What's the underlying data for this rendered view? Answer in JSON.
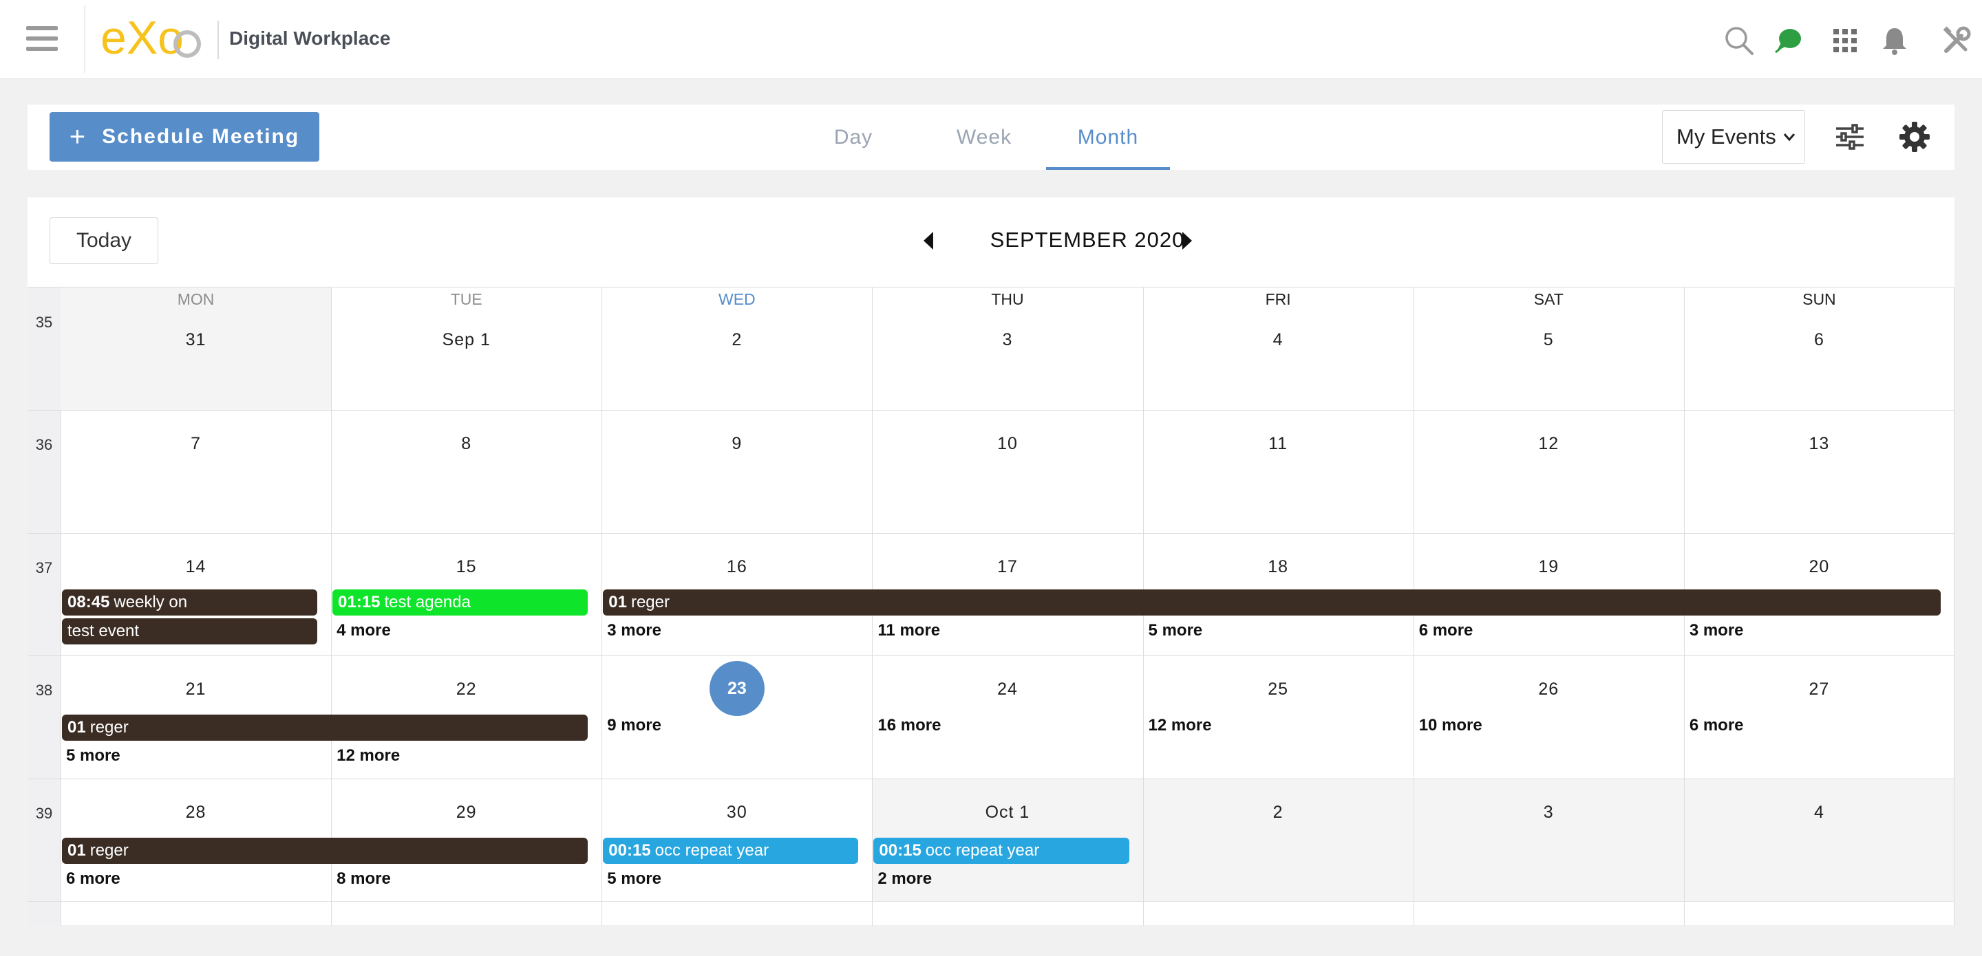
{
  "header": {
    "brand_title": "Digital Workplace",
    "logo_text": "eXo",
    "icons": [
      "menu-icon",
      "search-icon",
      "chat-icon",
      "apps-icon",
      "bell-icon",
      "tools-icon"
    ]
  },
  "toolbar": {
    "schedule_label": "Schedule Meeting",
    "tabs": [
      {
        "label": "Day",
        "active": false
      },
      {
        "label": "Week",
        "active": false
      },
      {
        "label": "Month",
        "active": true
      }
    ],
    "filter_value": "My Events"
  },
  "calendar": {
    "today_label": "Today",
    "month_title": "SEPTEMBER 2020",
    "day_headers": [
      "MON",
      "TUE",
      "WED",
      "THU",
      "FRI",
      "SAT",
      "SUN"
    ],
    "weeks": [
      {
        "num": "35",
        "days": [
          "31",
          "Sep 1",
          "2",
          "3",
          "4",
          "5",
          "6"
        ]
      },
      {
        "num": "36",
        "days": [
          "7",
          "8",
          "9",
          "10",
          "11",
          "12",
          "13"
        ]
      },
      {
        "num": "37",
        "days": [
          "14",
          "15",
          "16",
          "17",
          "18",
          "19",
          "20"
        ]
      },
      {
        "num": "38",
        "days": [
          "21",
          "22",
          "23",
          "24",
          "25",
          "26",
          "27"
        ]
      },
      {
        "num": "39",
        "days": [
          "28",
          "29",
          "30",
          "Oct 1",
          "2",
          "3",
          "4"
        ]
      }
    ],
    "today_date": "23",
    "events": [
      {
        "week": 2,
        "start": 0,
        "span": 1,
        "slot": 0,
        "time": "08:45",
        "title": "weekly on",
        "color": "#3b2d24"
      },
      {
        "week": 2,
        "start": 0,
        "span": 1,
        "slot": 1,
        "time": "",
        "title": "test event",
        "color": "#3b2d24"
      },
      {
        "week": 2,
        "start": 1,
        "span": 1,
        "slot": 0,
        "time": "01:15",
        "title": "test agenda",
        "color": "#0ee52a"
      },
      {
        "week": 2,
        "start": 2,
        "span": 5,
        "slot": 0,
        "time": "01",
        "title": "reger",
        "color": "#3b2d24"
      },
      {
        "week": 3,
        "start": 0,
        "span": 2,
        "slot": 0,
        "time": "01",
        "title": "reger",
        "color": "#3b2d24"
      },
      {
        "week": 4,
        "start": 0,
        "span": 2,
        "slot": 0,
        "time": "01",
        "title": "reger",
        "color": "#3b2d24"
      },
      {
        "week": 4,
        "start": 2,
        "span": 1,
        "slot": 0,
        "time": "00:15",
        "title": "occ repeat year",
        "color": "#27a6e0"
      },
      {
        "week": 4,
        "start": 3,
        "span": 1,
        "slot": 0,
        "time": "00:15",
        "title": "occ repeat year",
        "color": "#27a6e0"
      }
    ],
    "more_links": [
      {
        "week": 2,
        "day": 1,
        "slot": 1,
        "label": "4 more"
      },
      {
        "week": 2,
        "day": 2,
        "slot": 1,
        "label": "3 more"
      },
      {
        "week": 2,
        "day": 3,
        "slot": 1,
        "label": "11 more"
      },
      {
        "week": 2,
        "day": 4,
        "slot": 1,
        "label": "5 more"
      },
      {
        "week": 2,
        "day": 5,
        "slot": 1,
        "label": "6 more"
      },
      {
        "week": 2,
        "day": 6,
        "slot": 1,
        "label": "3 more"
      },
      {
        "week": 3,
        "day": 0,
        "slot": 1,
        "label": "5 more"
      },
      {
        "week": 3,
        "day": 1,
        "slot": 1,
        "label": "12 more"
      },
      {
        "week": 3,
        "day": 2,
        "slot": 0,
        "label": "9 more"
      },
      {
        "week": 3,
        "day": 3,
        "slot": 0,
        "label": "16 more"
      },
      {
        "week": 3,
        "day": 4,
        "slot": 0,
        "label": "12 more"
      },
      {
        "week": 3,
        "day": 5,
        "slot": 0,
        "label": "10 more"
      },
      {
        "week": 3,
        "day": 6,
        "slot": 0,
        "label": "6 more"
      },
      {
        "week": 4,
        "day": 0,
        "slot": 1,
        "label": "6 more"
      },
      {
        "week": 4,
        "day": 1,
        "slot": 1,
        "label": "8 more"
      },
      {
        "week": 4,
        "day": 2,
        "slot": 1,
        "label": "5 more"
      },
      {
        "week": 4,
        "day": 3,
        "slot": 1,
        "label": "2 more"
      }
    ]
  }
}
